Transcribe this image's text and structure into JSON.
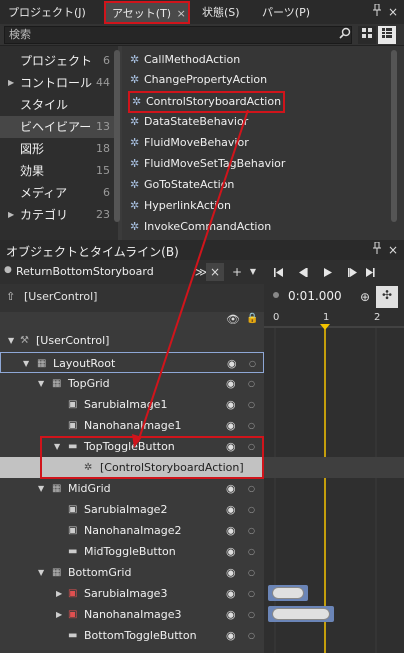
{
  "tabs": [
    {
      "label": "プロジェクト(J)"
    },
    {
      "label": "アセット(T)",
      "active": true
    },
    {
      "label": "状態(S)"
    },
    {
      "label": "パーツ(P)"
    }
  ],
  "tab_close": "×",
  "pin_icon": "pin-icon",
  "close_icon": "close-icon",
  "search": {
    "placeholder": "検索"
  },
  "categories": [
    {
      "label": "プロジェクト",
      "count": "6",
      "has_arrow": false
    },
    {
      "label": "コントロール",
      "count": "44",
      "has_arrow": true
    },
    {
      "label": "スタイル",
      "count": "",
      "has_arrow": false
    },
    {
      "label": "ビヘイビアー",
      "count": "13",
      "has_arrow": false,
      "selected": true
    },
    {
      "label": "図形",
      "count": "18",
      "has_arrow": false
    },
    {
      "label": "効果",
      "count": "15",
      "has_arrow": false
    },
    {
      "label": "メディア",
      "count": "6",
      "has_arrow": false
    },
    {
      "label": "カテゴリ",
      "count": "23",
      "has_arrow": true
    }
  ],
  "behaviors": [
    "CallMethodAction",
    "ChangePropertyAction",
    "ControlStoryboardAction",
    "DataStateBehavior",
    "FluidMoveBehavior",
    "FluidMoveSetTagBehavior",
    "GoToStateAction",
    "HyperlinkAction",
    "InvokeCommandAction"
  ],
  "objects_panel": {
    "title": "オブジェクトとタイムライン(B)",
    "storyboard": "ReturnBottomStoryboard",
    "scope": "[UserControl]",
    "time": "0:01.000",
    "ruler": [
      "0",
      "1",
      "2"
    ]
  },
  "tree": [
    {
      "label": "[UserControl]",
      "indent": 0,
      "icon": "usercontrol"
    },
    {
      "label": "LayoutRoot",
      "indent": 1,
      "icon": "grid",
      "outlined": true
    },
    {
      "label": "TopGrid",
      "indent": 2,
      "icon": "grid"
    },
    {
      "label": "SarubiaImage1",
      "indent": 3,
      "icon": "image"
    },
    {
      "label": "NanohanaImage1",
      "indent": 3,
      "icon": "image"
    },
    {
      "label": "TopToggleButton",
      "indent": 3,
      "icon": "button",
      "expanded": true
    },
    {
      "label": "[ControlStoryboardAction]",
      "indent": 4,
      "icon": "behavior",
      "selected": true
    },
    {
      "label": "MidGrid",
      "indent": 2,
      "icon": "grid"
    },
    {
      "label": "SarubiaImage2",
      "indent": 3,
      "icon": "image"
    },
    {
      "label": "NanohanaImage2",
      "indent": 3,
      "icon": "image"
    },
    {
      "label": "MidToggleButton",
      "indent": 3,
      "icon": "button"
    },
    {
      "label": "BottomGrid",
      "indent": 2,
      "icon": "grid"
    },
    {
      "label": "SarubiaImage3",
      "indent": 3,
      "icon": "image-red"
    },
    {
      "label": "NanohanaImage3",
      "indent": 3,
      "icon": "image-red"
    },
    {
      "label": "BottomToggleButton",
      "indent": 3,
      "icon": "button"
    }
  ],
  "colors": {
    "accent": "#d0141b",
    "playhead": "#f5c400",
    "selection": "#c2c2c2"
  }
}
